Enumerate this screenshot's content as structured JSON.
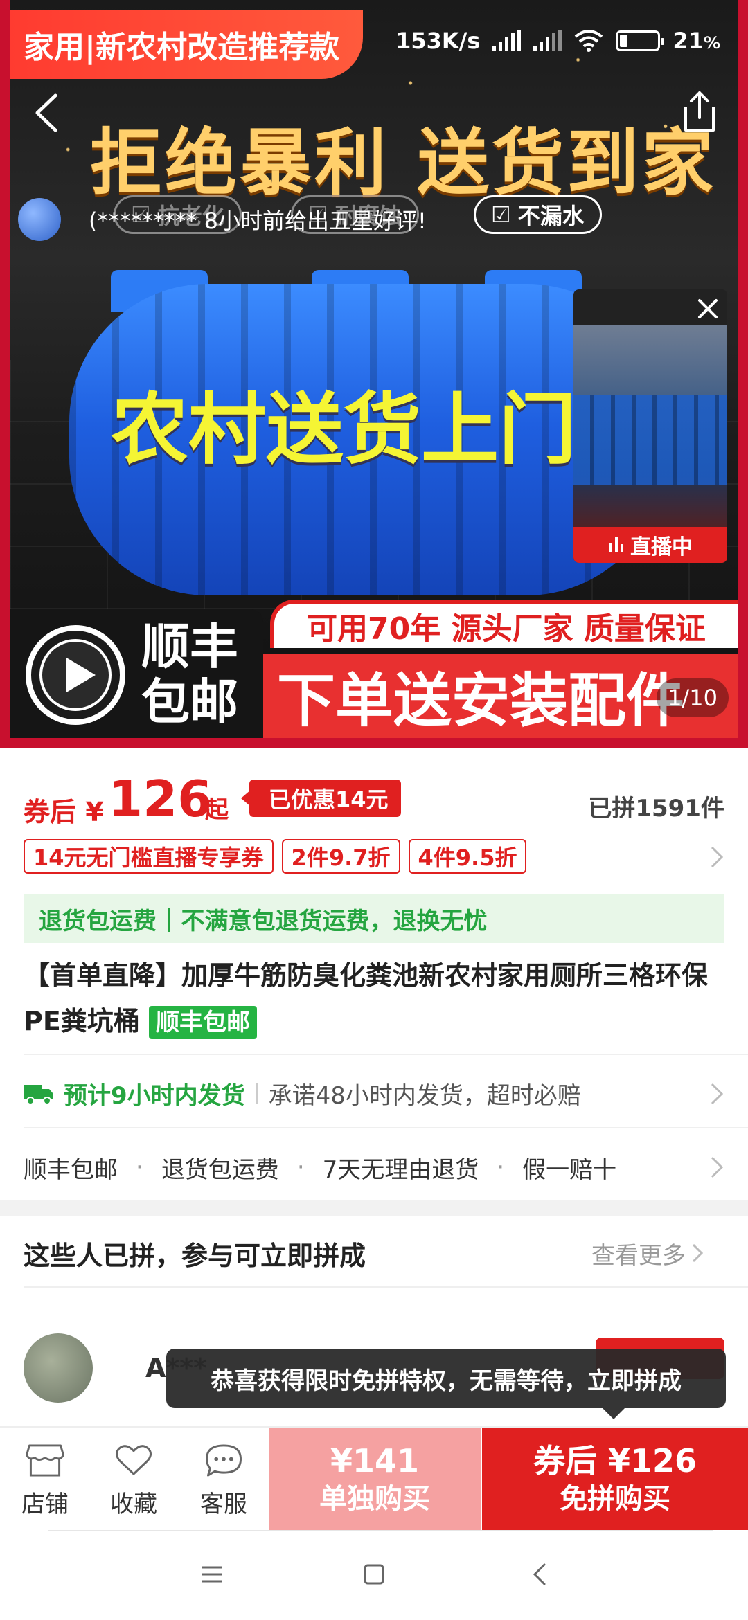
{
  "status_bar": {
    "net_speed": "153K/s",
    "battery": "21",
    "battery_unit": "%"
  },
  "hero": {
    "promo_tag": "家用|新农村改造推荐款",
    "headline": "拒绝暴利 送货到家",
    "review_text": "(********* 8小时前给出五星好评!",
    "feature_tags": [
      "抗老化",
      "耐腐蚀",
      "不漏水"
    ],
    "tank_text": "农村送货上门",
    "live_label": "直播中",
    "sf_line1": "顺丰",
    "sf_line2": "包邮",
    "banner_top": "可用70年 源头厂家 质量保证",
    "banner_bottom": "下单送安装配件",
    "page_indicator": "1/10"
  },
  "price": {
    "prefix": "券后 ¥",
    "value": "126",
    "suffix": "起",
    "saved": "已优惠14元",
    "sold": "已拼1591件"
  },
  "coupons": [
    "14元无门槛直播专享券",
    "2件9.7折",
    "4件9.5折"
  ],
  "return_bar": {
    "left": "退货包运费",
    "right": "不满意包退货运费，退换无忧"
  },
  "product": {
    "title": "【首单直降】加厚牛筋防臭化粪池新农村家用厕所三格环保PE粪坑桶",
    "title_tag": "顺丰包邮"
  },
  "shipping": {
    "estimate": "预计9小时内发货",
    "promise": "承诺48小时内发货，超时必赔"
  },
  "services": [
    "顺丰包邮",
    "退货包运费",
    "7天无理由退货",
    "假一赔十"
  ],
  "group": {
    "heading": "这些人已拼，参与可立即拼成",
    "more": "查看更多",
    "member_name": "A***",
    "toast": "恭喜获得限时免拼特权，无需等待，立即拼成"
  },
  "bottom_bar": {
    "store": "店铺",
    "favorite": "收藏",
    "service": "客服",
    "single_price": "¥141",
    "single_label": "单独购买",
    "group_price": "券后 ¥126",
    "group_label": "免拼购买"
  },
  "colors": {
    "accent": "#e02020",
    "green": "#25a540",
    "light_red": "#f5a1a1"
  }
}
